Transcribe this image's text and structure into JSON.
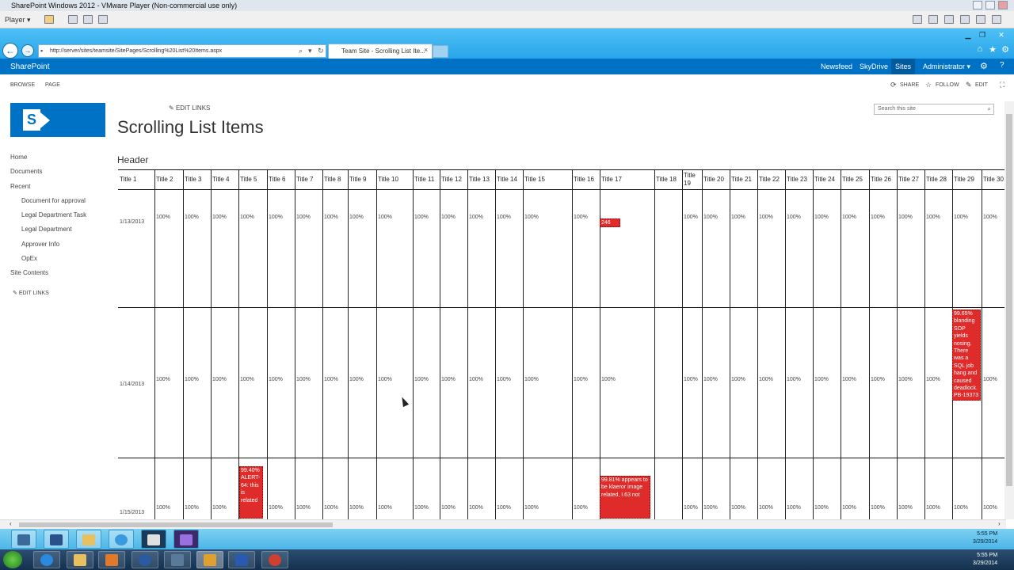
{
  "vm": {
    "title": "SharePoint Windows 2012 - VMware Player (Non-commercial use only)",
    "player_menu": "Player ▾"
  },
  "browser": {
    "url": "http://server/sites/teamsite/SitePages/Scrolling%20List%20Items.aspx",
    "tab_title": "Team Site - Scrolling List Ite..."
  },
  "suite": {
    "brand": "SharePoint",
    "links": [
      "Newsfeed",
      "SkyDrive",
      "Sites"
    ],
    "user": "Administrator ▾",
    "help": "?"
  },
  "ribbon": {
    "tabs": [
      "BROWSE",
      "PAGE"
    ],
    "actions": {
      "share": "SHARE",
      "follow": "FOLLOW",
      "edit": "EDIT"
    }
  },
  "page": {
    "edit_links_top": "EDIT LINKS",
    "title": "Scrolling List Items",
    "search_placeholder": "Search this site",
    "header_label": "Header"
  },
  "quick_launch": {
    "items": [
      "Home",
      "Documents",
      "Recent",
      "Document for approval",
      "Legal Department Task",
      "Legal Department",
      "Approver Info",
      "OpEx",
      "Site Contents"
    ],
    "edit_links": "EDIT LINKS"
  },
  "list": {
    "headers": [
      "Title 1",
      "Title 2",
      "Title 3",
      "Title 4",
      "Title 5",
      "Title 6",
      "Title 7",
      "Title 8",
      "Title 9",
      "Title 10",
      "Title 11",
      "Title 12",
      "Title 13",
      "Title 14",
      "Title 15",
      "Title 16",
      "Title 17",
      "Title 18",
      "Title 19",
      "Title 20",
      "Title 21",
      "Title 22",
      "Title 23",
      "Title 24",
      "Title 25",
      "Title 26",
      "Title 27",
      "Title 28",
      "Title 29",
      "Title 30"
    ],
    "rows": [
      {
        "date": "1/13/2013",
        "value": "100%",
        "note_title17": "246"
      },
      {
        "date": "1/14/2013",
        "value": "100%",
        "note_title29": "99.65% blanding SOP yields nosing. There was a SQL job hang and caused deadlock. PB-19373"
      },
      {
        "date": "1/15/2013",
        "value": "100%",
        "note_title5": "99.40% ALERT-64: this is related",
        "note_title17": "99.81% appears to be klaeror image related, I.63 not"
      }
    ]
  },
  "inner_clock": {
    "time": "5:55 PM",
    "date": "3/29/2014"
  },
  "outer_clock": {
    "time": "5:55 PM",
    "date": "3/29/2014"
  }
}
